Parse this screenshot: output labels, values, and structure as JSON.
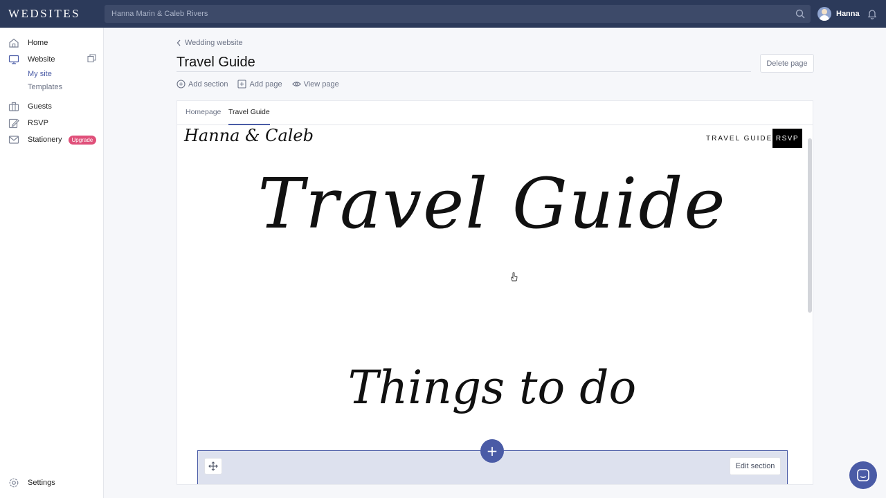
{
  "app": {
    "logo": "WEDSITES",
    "search_value": "Hanna Marin & Caleb Rivers",
    "user_name": "Hanna"
  },
  "sidebar": {
    "items": [
      {
        "label": "Home",
        "icon": "home-icon"
      },
      {
        "label": "Website",
        "icon": "monitor-icon"
      },
      {
        "label": "Guests",
        "icon": "guests-icon"
      },
      {
        "label": "RSVP",
        "icon": "edit-icon"
      },
      {
        "label": "Stationery",
        "icon": "mail-icon",
        "badge": "Upgrade"
      }
    ],
    "website_sub": [
      {
        "label": "My site",
        "active": true
      },
      {
        "label": "Templates",
        "active": false
      }
    ],
    "settings_label": "Settings"
  },
  "header": {
    "breadcrumb": "Wedding website",
    "title": "Travel Guide",
    "delete_label": "Delete page",
    "actions": {
      "add_section": "Add section",
      "add_page": "Add page",
      "view_page": "View page"
    }
  },
  "editor": {
    "tabs": [
      {
        "label": "Homepage",
        "active": false
      },
      {
        "label": "Travel Guide",
        "active": true
      }
    ],
    "site": {
      "logo_text": "Hanna & Caleb",
      "nav_link": "TRAVEL GUIDE",
      "rsvp_label": "RSVP",
      "hero_title": "Travel Guide",
      "section_title": "Things to do"
    },
    "section_bar": {
      "edit_label": "Edit section",
      "add_symbol": "+"
    }
  },
  "colors": {
    "topbar": "#2c3a5a",
    "accent": "#4a5ba6",
    "badge": "#e0507a"
  }
}
